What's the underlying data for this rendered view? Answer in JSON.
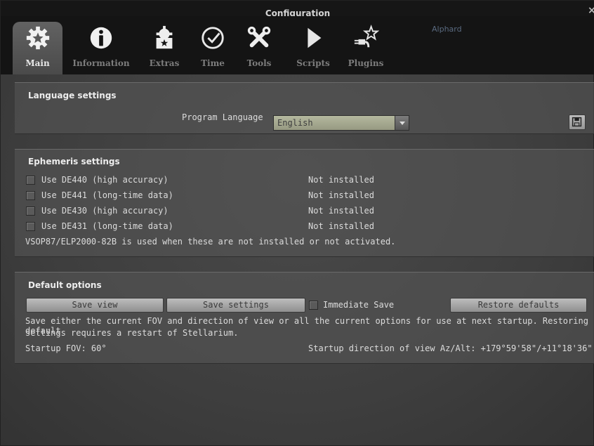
{
  "window": {
    "title": "Configuration",
    "close_glyph": "×"
  },
  "sky": {
    "star_label": "Alphard"
  },
  "tabs": [
    {
      "label": "Main",
      "icon": "gear-icon",
      "active": true
    },
    {
      "label": "Information",
      "icon": "info-icon",
      "active": false
    },
    {
      "label": "Extras",
      "icon": "extras-icon",
      "active": false
    },
    {
      "label": "Time",
      "icon": "clock-icon",
      "active": false
    },
    {
      "label": "Tools",
      "icon": "tools-icon",
      "active": false
    },
    {
      "label": "Scripts",
      "icon": "play-icon",
      "active": false
    },
    {
      "label": "Plugins",
      "icon": "plugin-icon",
      "active": false
    }
  ],
  "language": {
    "heading": "Language settings",
    "program_language_label": "Program Language",
    "program_language_value": "English"
  },
  "ephemeris": {
    "heading": "Ephemeris settings",
    "items": [
      {
        "label": "Use DE440 (high accuracy)",
        "status": "Not installed",
        "checked": false
      },
      {
        "label": "Use DE441 (long-time data)",
        "status": "Not installed",
        "checked": false
      },
      {
        "label": "Use DE430 (high accuracy)",
        "status": "Not installed",
        "checked": false
      },
      {
        "label": "Use DE431 (long-time data)",
        "status": "Not installed",
        "checked": false
      }
    ],
    "note": "VSOP87/ELP2000-82B is used when these are not installed or not activated."
  },
  "defaults": {
    "heading": "Default options",
    "save_view_label": "Save view",
    "save_settings_label": "Save settings",
    "immediate_save_label": "Immediate Save",
    "restore_defaults_label": "Restore defaults",
    "description_line1": "Save either the current FOV and direction of view or all the current options for use at next startup. Restoring default",
    "description_line2": "settings requires a restart of Stellarium.",
    "startup_fov": "Startup FOV: 60°",
    "startup_direction": "Startup direction of view Az/Alt: +179°59'58\"/+11°18'36\""
  },
  "colors": {
    "accent": "#e8e8e8",
    "panel": "#585858"
  }
}
